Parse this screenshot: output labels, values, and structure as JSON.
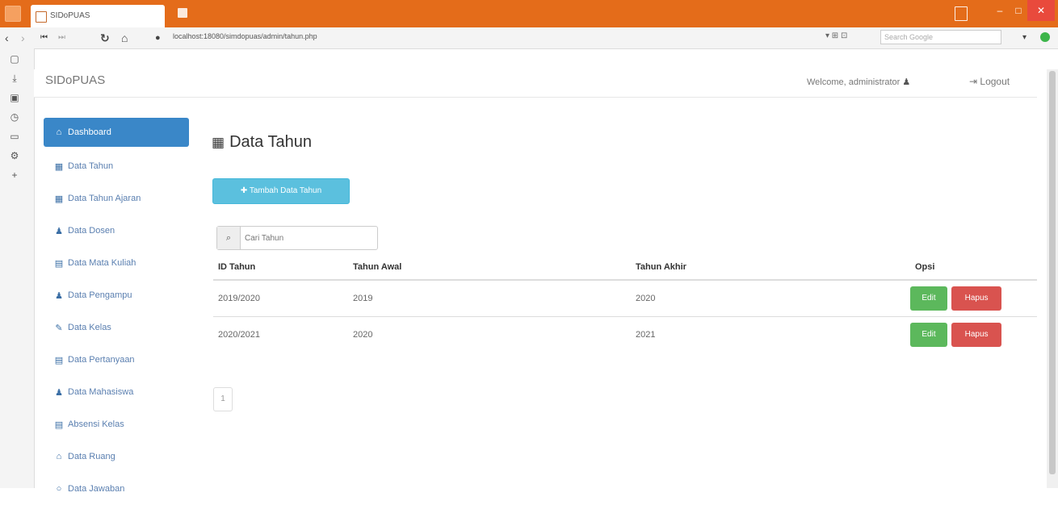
{
  "browser": {
    "tab_title": "SIDoPUAS",
    "url": "localhost:18080/simdopuas/admin/tahun.php",
    "search_placeholder": "Search Google",
    "window_controls": {
      "minimize": "–",
      "maximize": "□",
      "close": "✕"
    }
  },
  "header": {
    "brand": "SIDoPUAS",
    "welcome": "Welcome, administrator",
    "logout": "Logout"
  },
  "sidebar": {
    "items": [
      {
        "label": "Dashboard",
        "icon": "home-icon",
        "glyph": "⌂",
        "active": true
      },
      {
        "label": "Data Tahun",
        "icon": "calendar-icon",
        "glyph": "▦"
      },
      {
        "label": "Data Tahun Ajaran",
        "icon": "calendar-icon",
        "glyph": "▦"
      },
      {
        "label": "Data Dosen",
        "icon": "user-icon",
        "glyph": "♟"
      },
      {
        "label": "Data Mata Kuliah",
        "icon": "list-icon",
        "glyph": "▤"
      },
      {
        "label": "Data Pengampu",
        "icon": "user-icon",
        "glyph": "♟"
      },
      {
        "label": "Data Kelas",
        "icon": "pencil-icon",
        "glyph": "✎"
      },
      {
        "label": "Data Pertanyaan",
        "icon": "book-icon",
        "glyph": "▤"
      },
      {
        "label": "Data Mahasiswa",
        "icon": "user-icon",
        "glyph": "♟"
      },
      {
        "label": "Absensi Kelas",
        "icon": "list-icon",
        "glyph": "▤"
      },
      {
        "label": "Data Ruang",
        "icon": "home-icon",
        "glyph": "⌂"
      },
      {
        "label": "Data Jawaban",
        "icon": "circle-icon",
        "glyph": "○"
      }
    ]
  },
  "main": {
    "title": "Data Tahun",
    "add_button": "Tambah Data Tahun",
    "search_placeholder": "Cari Tahun",
    "table": {
      "headers": [
        "ID Tahun",
        "Tahun Awal",
        "Tahun Akhir",
        "Opsi"
      ],
      "rows": [
        [
          "2019/2020",
          "2019",
          "2020"
        ],
        [
          "2020/2021",
          "2020",
          "2021"
        ]
      ],
      "edit_label": "Edit",
      "delete_label": "Hapus"
    },
    "pagination": "1"
  },
  "colors": {
    "titlebar": "#e46c1a",
    "active_menu": "#3a87c8",
    "info_button": "#5bc0de",
    "edit_button": "#5cb85c",
    "delete_button": "#d9534f"
  }
}
